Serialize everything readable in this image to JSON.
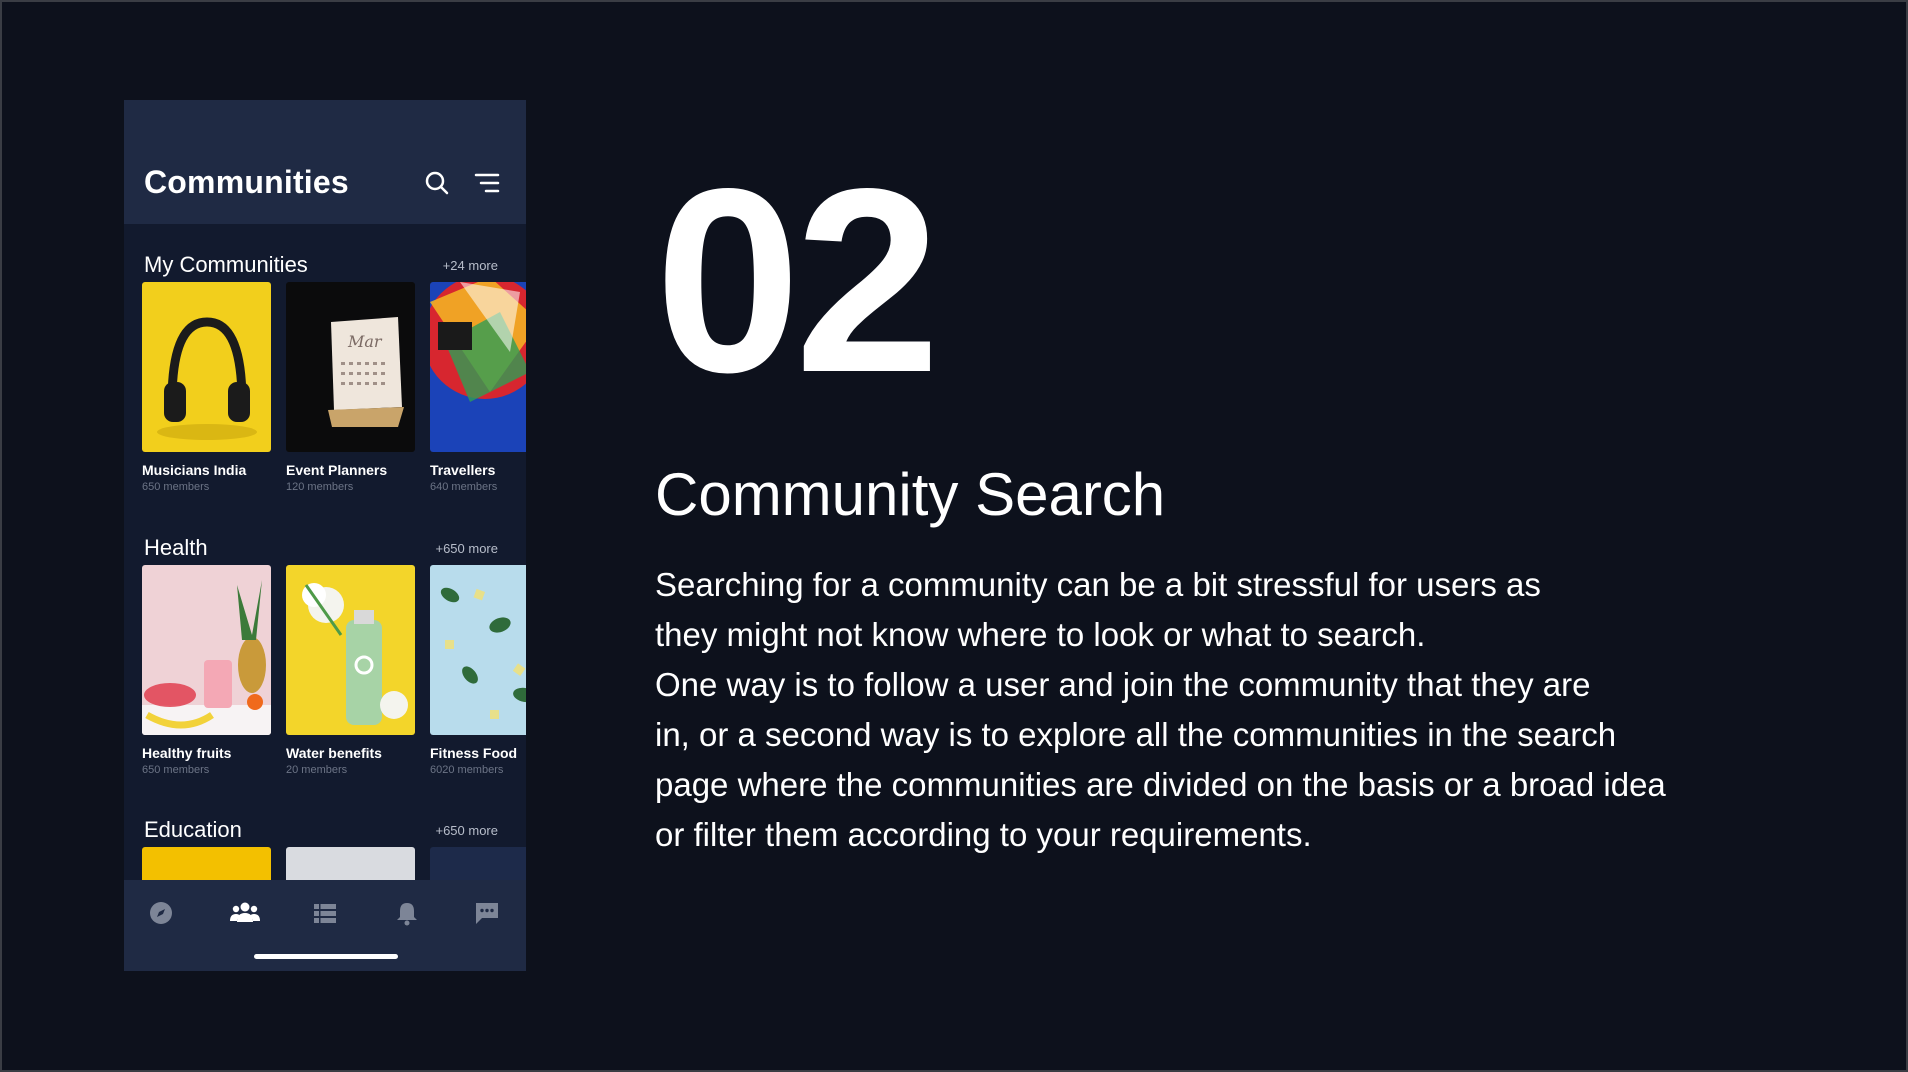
{
  "phone": {
    "title": "Communities",
    "sections": [
      {
        "title": "My Communities",
        "more": "+24 more",
        "cards": [
          {
            "name": "Musicians India",
            "members": "650 members",
            "image": "headphones-image"
          },
          {
            "name": "Event Planners",
            "members": "120 members",
            "image": "calendar-image"
          },
          {
            "name": "Travellers",
            "members": "640 members",
            "image": "hot-air-balloon-image"
          }
        ]
      },
      {
        "title": "Health",
        "more": "+650 more",
        "cards": [
          {
            "name": "Healthy fruits",
            "members": "650 members",
            "image": "fruits-image"
          },
          {
            "name": "Water benefits",
            "members": "20 members",
            "image": "water-bottle-image"
          },
          {
            "name": "Fitness Food",
            "members": "6020 members",
            "image": "fitness-food-image"
          }
        ]
      },
      {
        "title": "Education",
        "more": "+650 more"
      }
    ],
    "tabs": [
      "compass-icon",
      "community-icon",
      "feed-icon",
      "bell-icon",
      "chat-icon"
    ],
    "active_tab": "community-icon"
  },
  "slide": {
    "number": "02",
    "title": "Community Search",
    "description_lines": [
      "Searching for a community can be a bit stressful for users as",
      "they might not know where to look or what to search.",
      "One way is to follow a user and join the community that they are",
      "in,  or a second way is to explore all the communities in the search",
      "page where the communities are divided on the basis or a broad idea",
      "or filter them according to your requirements."
    ]
  },
  "colors": {
    "background": "#0d111c",
    "phone_header": "#1f2a44",
    "phone_body": "#121a2e",
    "text": "#ffffff",
    "muted": "#6c7486"
  }
}
